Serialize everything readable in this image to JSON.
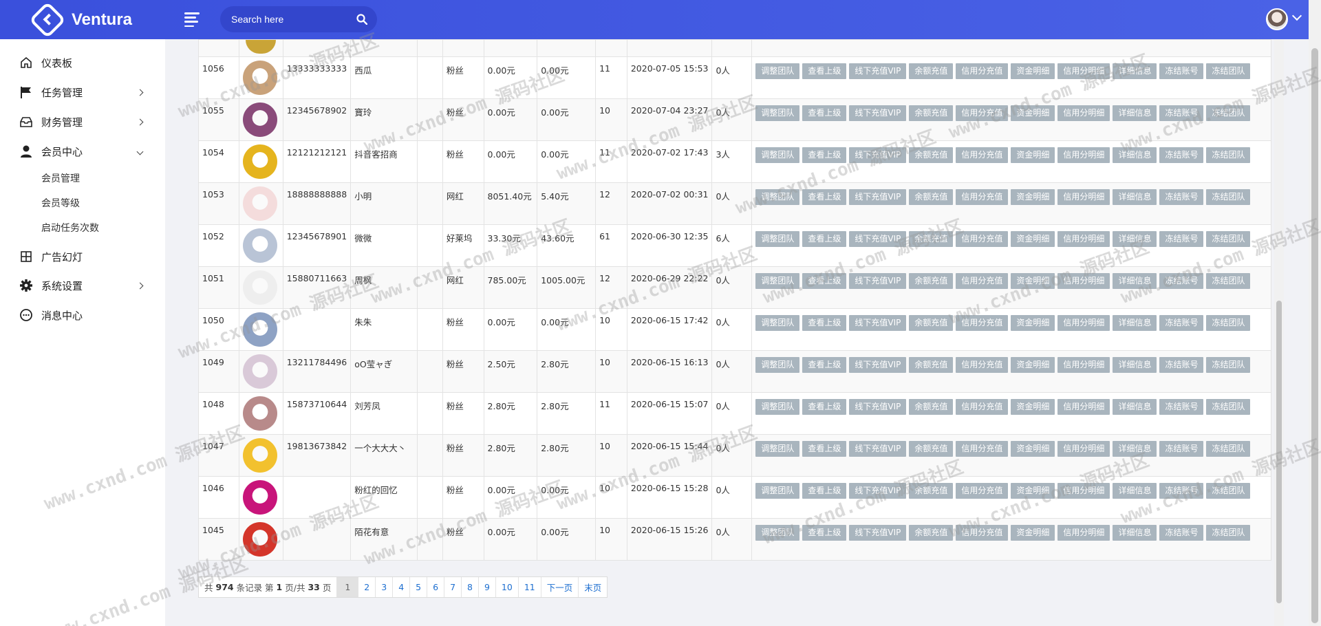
{
  "app": {
    "name": "Ventura"
  },
  "header": {
    "search_placeholder": "Search here"
  },
  "sidebar": {
    "items": [
      {
        "label": "仪表板",
        "icon": "home-icon"
      },
      {
        "label": "任务管理",
        "icon": "flag-icon"
      },
      {
        "label": "财务管理",
        "icon": "inbox-icon"
      },
      {
        "label": "会员中心",
        "icon": "user-icon"
      },
      {
        "label": "广告幻灯",
        "icon": "grid-icon"
      },
      {
        "label": "系统设置",
        "icon": "gear-icon"
      },
      {
        "label": "消息中心",
        "icon": "chat-icon"
      }
    ],
    "sub_items": [
      "会员管理",
      "会员等级",
      "启动任务次数"
    ]
  },
  "actions": [
    "调整团队",
    "查看上级",
    "线下充值VIP",
    "余额充值",
    "信用分充值",
    "资金明细",
    "信用分明细",
    "详细信息",
    "冻结账号",
    "冻结团队"
  ],
  "rows": [
    {
      "id": "1056",
      "phone": "13333333333",
      "name": "西瓜",
      "level": "粉丝",
      "balance": "0.00元",
      "total": "0.00元",
      "count": "11",
      "time": "2020-07-05 15:53",
      "team": "0人",
      "avatar": "#c9a27a"
    },
    {
      "id": "1055",
      "phone": "12345678902",
      "name": "寶玲",
      "level": "粉丝",
      "balance": "0.00元",
      "total": "0.00元",
      "count": "10",
      "time": "2020-07-04 23:27",
      "team": "0人",
      "avatar": "#8a4b7a"
    },
    {
      "id": "1054",
      "phone": "12121212121",
      "name": "抖音客招商",
      "level": "粉丝",
      "balance": "0.00元",
      "total": "0.00元",
      "count": "11",
      "time": "2020-07-02 17:43",
      "team": "3人",
      "avatar": "#e5b41e"
    },
    {
      "id": "1053",
      "phone": "18888888888",
      "name": "小明",
      "level": "网红",
      "balance": "8051.40元",
      "total": "5.40元",
      "count": "12",
      "time": "2020-07-02 00:31",
      "team": "0人",
      "avatar": "#f4dcdc"
    },
    {
      "id": "1052",
      "phone": "12345678901",
      "name": "微微",
      "level": "好莱坞",
      "balance": "33.30元",
      "total": "43.60元",
      "count": "61",
      "time": "2020-06-30 12:35",
      "team": "6人",
      "avatar": "#b9c4d6"
    },
    {
      "id": "1051",
      "phone": "15880711663",
      "name": "周枫",
      "level": "网红",
      "balance": "785.00元",
      "total": "1005.00元",
      "count": "12",
      "time": "2020-06-29 22:22",
      "team": "0人",
      "avatar": "#eeeeee"
    },
    {
      "id": "1050",
      "phone": "",
      "name": "朱朱",
      "level": "粉丝",
      "balance": "0.00元",
      "total": "0.00元",
      "count": "10",
      "time": "2020-06-15 17:42",
      "team": "0人",
      "avatar": "#8ea2c4"
    },
    {
      "id": "1049",
      "phone": "13211784496",
      "name": "oO莹ャぎ",
      "level": "粉丝",
      "balance": "2.50元",
      "total": "2.80元",
      "count": "10",
      "time": "2020-06-15 16:13",
      "team": "0人",
      "avatar": "#d9c9d8"
    },
    {
      "id": "1048",
      "phone": "15873710644",
      "name": "刘芳凤",
      "level": "粉丝",
      "balance": "2.80元",
      "total": "2.80元",
      "count": "11",
      "time": "2020-06-15 15:07",
      "team": "0人",
      "avatar": "#b88a8a"
    },
    {
      "id": "1047",
      "phone": "19813673842",
      "name": "一个大大大丶",
      "level": "粉丝",
      "balance": "2.80元",
      "total": "2.80元",
      "count": "10",
      "time": "2020-06-15 15:44",
      "team": "0人",
      "avatar": "#f2c12e"
    },
    {
      "id": "1046",
      "phone": "",
      "name": "粉红的回忆",
      "level": "粉丝",
      "balance": "0.00元",
      "total": "0.00元",
      "count": "10",
      "time": "2020-06-15 15:28",
      "team": "0人",
      "avatar": "#c8147a"
    },
    {
      "id": "1045",
      "phone": "",
      "name": "陌花有意",
      "level": "粉丝",
      "balance": "0.00元",
      "total": "0.00元",
      "count": "10",
      "time": "2020-06-15 15:26",
      "team": "0人",
      "avatar": "#d4352a"
    }
  ],
  "pager": {
    "info_prefix": "共",
    "total": "974",
    "info_mid": "条记录 第",
    "current": "1",
    "info_mid2": "页/共",
    "pages_total": "33",
    "info_suffix": "页",
    "pages": [
      "1",
      "2",
      "3",
      "4",
      "5",
      "6",
      "7",
      "8",
      "9",
      "10",
      "11"
    ],
    "next": "下一页",
    "last": "末页"
  },
  "watermark": "www.cxnd.com 源码社区"
}
